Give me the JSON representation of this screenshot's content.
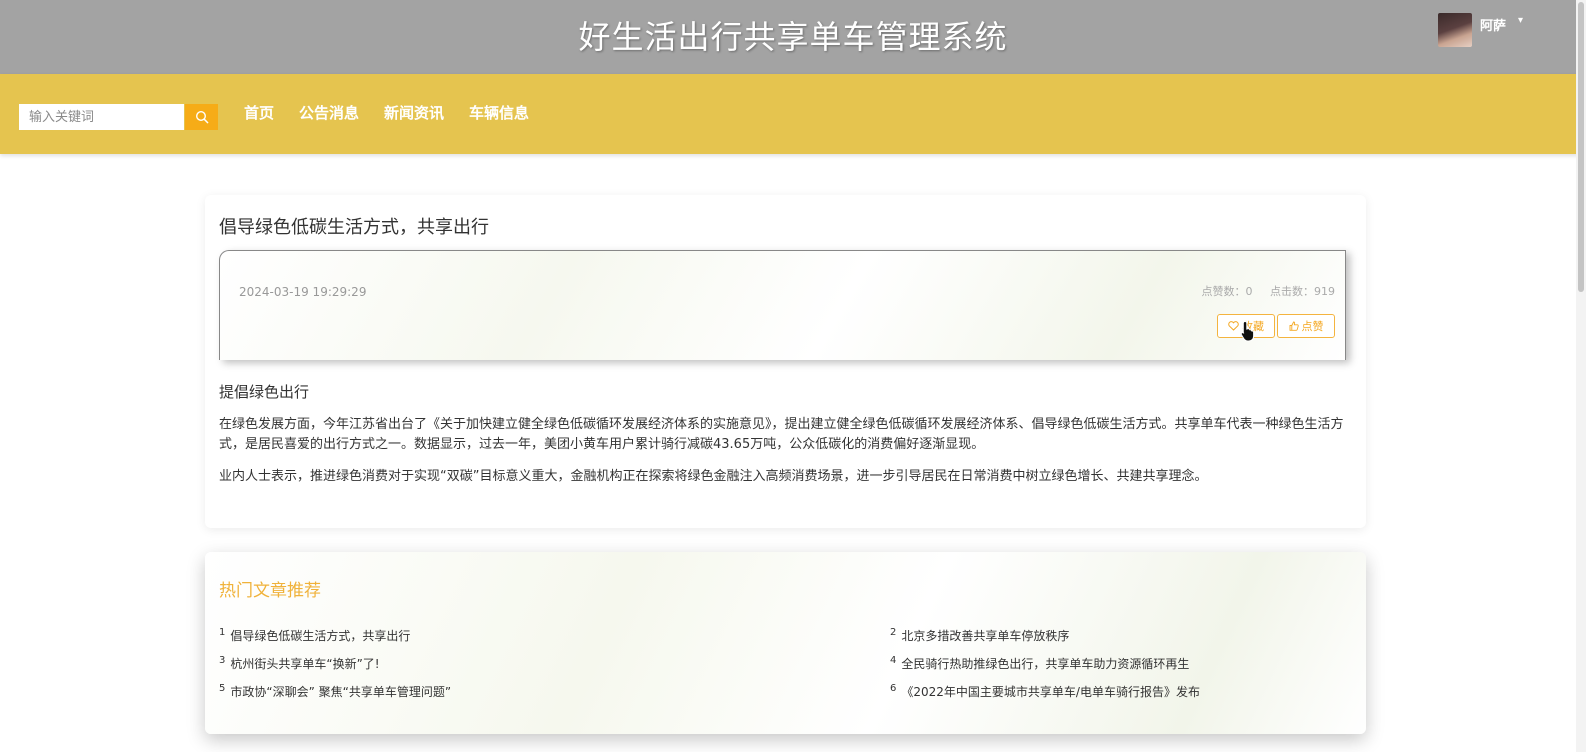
{
  "header": {
    "site_title": "好生活出行共享单车管理系统",
    "user_name": "阿萨",
    "caret": "▾"
  },
  "search": {
    "placeholder": "输入关键词",
    "value": ""
  },
  "nav": {
    "items": [
      {
        "label": "首页"
      },
      {
        "label": "公告消息"
      },
      {
        "label": "新闻资讯"
      },
      {
        "label": "车辆信息"
      }
    ]
  },
  "article": {
    "title": "倡导绿色低碳生活方式，共享出行",
    "date": "2024-03-19 19:29:29",
    "likes_label": "点赞数：0",
    "clicks_label": "点击数：919",
    "collect_label": "收藏",
    "like_button_label": "点赞",
    "subtitle": "提倡绿色出行",
    "paragraphs": [
      "在绿色发展方面，今年江苏省出台了《关于加快建立健全绿色低碳循环发展经济体系的实施意见》，提出建立健全绿色低碳循环发展经济体系、倡导绿色低碳生活方式。共享单车代表一种绿色生活方式，是居民喜爱的出行方式之一。数据显示，过去一年，美团小黄车用户累计骑行减碳43.65万吨，公众低碳化的消费偏好逐渐显现。",
      "业内人士表示，推进绿色消费对于实现“双碳”目标意义重大，金融机构正在探索将绿色金融注入高频消费场景，进一步引导居民在日常消费中树立绿色增长、共建共享理念。"
    ]
  },
  "hot": {
    "title": "热门文章推荐",
    "items": [
      {
        "rank": "1",
        "title": "倡导绿色低碳生活方式，共享出行"
      },
      {
        "rank": "2",
        "title": "北京多措改善共享单车停放秩序"
      },
      {
        "rank": "3",
        "title": "杭州街头共享单车“换新”了!"
      },
      {
        "rank": "4",
        "title": "全民骑行热助推绿色出行，共享单车助力资源循环再生"
      },
      {
        "rank": "5",
        "title": "市政协“深聊会” 聚焦“共享单车管理问题”"
      },
      {
        "rank": "6",
        "title": "《2022年中国主要城市共享单车/电单车骑行报告》发布"
      }
    ]
  },
  "colors": {
    "header_bg": "#a3a3a3",
    "nav_bg": "#e5c44f",
    "accent": "#f6ac17",
    "hot_title": "#f0b23a"
  },
  "icons": [
    "search-icon",
    "heart-icon",
    "thumbs-up-icon",
    "pointer-cursor-icon",
    "chevron-down-icon"
  ]
}
